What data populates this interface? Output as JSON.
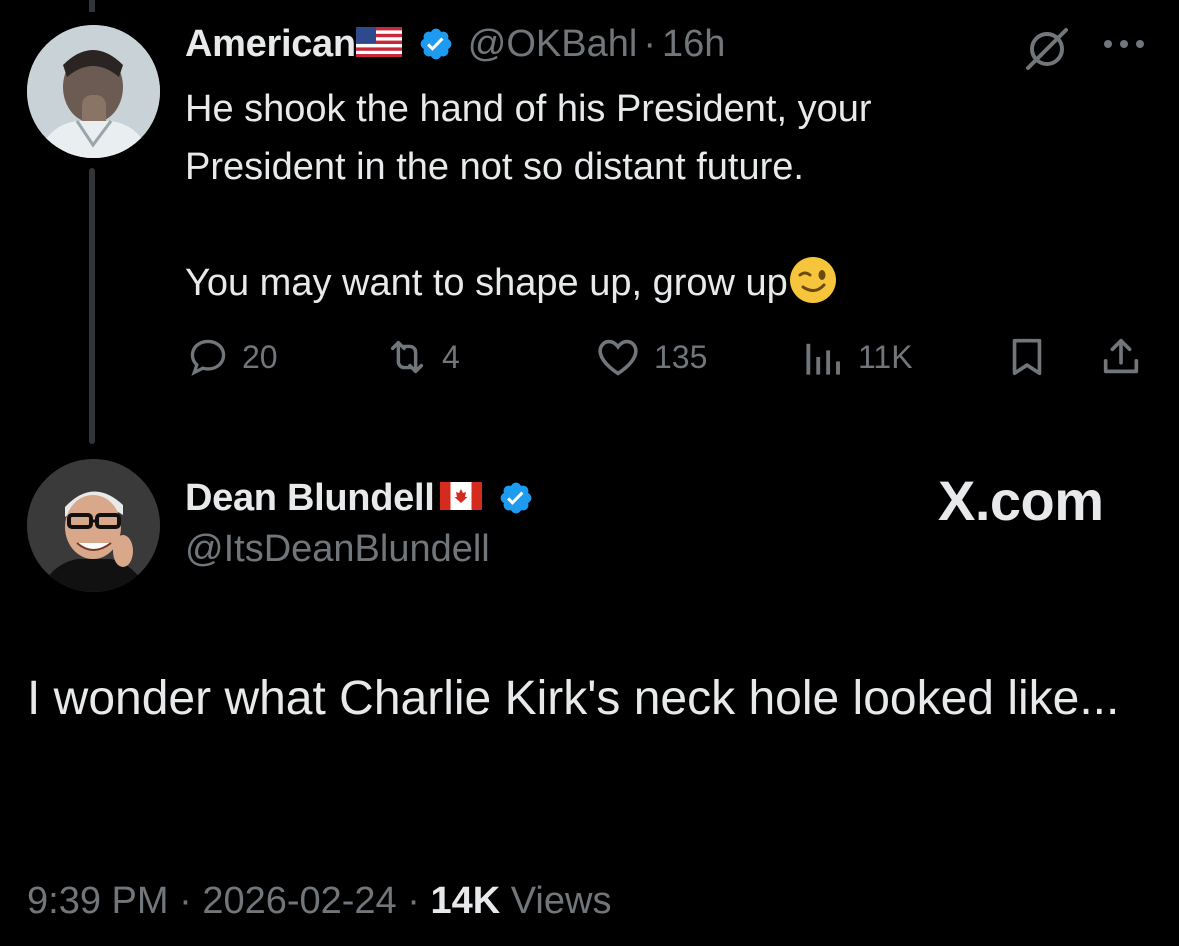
{
  "reply": {
    "author": {
      "display_name": "American",
      "flag": "us-flag",
      "verified": true,
      "handle": "@OKBahl",
      "separator": "·",
      "relative_time": "16h"
    },
    "body_lines": [
      "He shook the hand of his President, your",
      "President in the not so distant future."
    ],
    "body_line_3": "You may want to shape up, grow up",
    "body_emoji": "wink-emoji",
    "actions": {
      "replies": "20",
      "reposts": "4",
      "likes": "135",
      "views": "11K"
    },
    "header_icons": [
      "grok-icon",
      "more-icon"
    ]
  },
  "main_tweet": {
    "author": {
      "display_name": "Dean Blundell",
      "flag": "canada-flag",
      "verified": true,
      "handle": "@ItsDeanBlundell"
    },
    "watermark": "X.com",
    "body": "I wonder what Charlie Kirk's neck hole looked like...",
    "meta": {
      "time": "9:39 PM",
      "separator": "·",
      "date": "2026-02-24",
      "views_count": "14K",
      "views_label": "Views"
    }
  },
  "colors": {
    "background": "#000000",
    "text": "#e7e9ea",
    "muted": "#71767b",
    "verified_blue": "#1d9bf0",
    "thread_line": "#333639"
  }
}
